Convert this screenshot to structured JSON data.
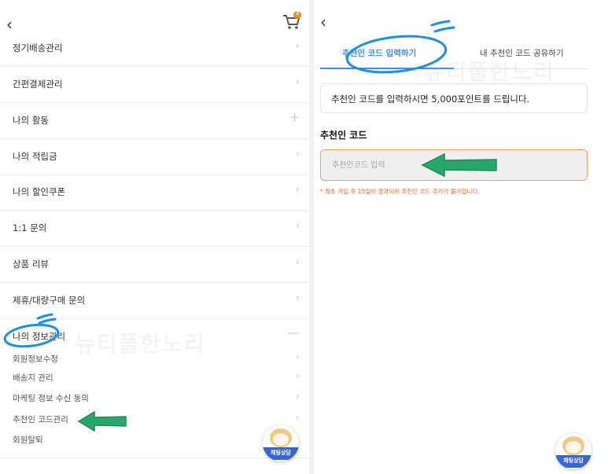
{
  "left_panel": {
    "cart_badge_count": "2",
    "menu": [
      {
        "label": "정기배송관리",
        "indicator": "chevron"
      },
      {
        "label": "간편결제관리",
        "indicator": "chevron"
      },
      {
        "label": "나의 활동",
        "indicator": "plus"
      },
      {
        "label": "나의 적립금",
        "indicator": "chevron"
      },
      {
        "label": "나의 할인쿠폰",
        "indicator": "chevron"
      },
      {
        "label": "1:1 문의",
        "indicator": "chevron"
      },
      {
        "label": "상품 리뷰",
        "indicator": "chevron"
      },
      {
        "label": "제휴/대량구매 문의",
        "indicator": "chevron"
      },
      {
        "label": "나의 정보관리",
        "indicator": "minus"
      }
    ],
    "sub_menu": [
      {
        "label": "회원정보수정"
      },
      {
        "label": "배송지 관리"
      },
      {
        "label": "마케팅 정보 수신 동의"
      },
      {
        "label": "추천인 코드관리"
      },
      {
        "label": "회원탈퇴"
      }
    ],
    "chat_label": "채팅상담",
    "watermark": "뉴티풀한노리"
  },
  "right_panel": {
    "tabs": [
      {
        "label": "추천인 코드 입력하기",
        "active": true
      },
      {
        "label": "내 추천인 코드 공유하기",
        "active": false
      }
    ],
    "info_text": "추천인 코드를 입력하시면 5,000포인트를 드립니다.",
    "section_title": "추천인 코드",
    "input_placeholder": "추천인코드 입력",
    "input_value": "",
    "notice": "* 최초 가입 후 15일이 경과되어 추천인 코드 추가가 불가합니다.",
    "chat_label": "채팅상담",
    "watermark": "뉴티풀한노리"
  },
  "colors": {
    "accent_blue": "#3a8edb",
    "annotation_circle": "#1e8fe6",
    "annotation_arrow": "#27a86a",
    "input_border": "#f29c6b",
    "notice": "#f36b2c",
    "cart_badge": "#f28a1d"
  },
  "icons": [
    "back-arrow-icon",
    "cart-icon",
    "chevron-right-icon",
    "plus-icon",
    "minus-icon",
    "chat-character-icon"
  ]
}
